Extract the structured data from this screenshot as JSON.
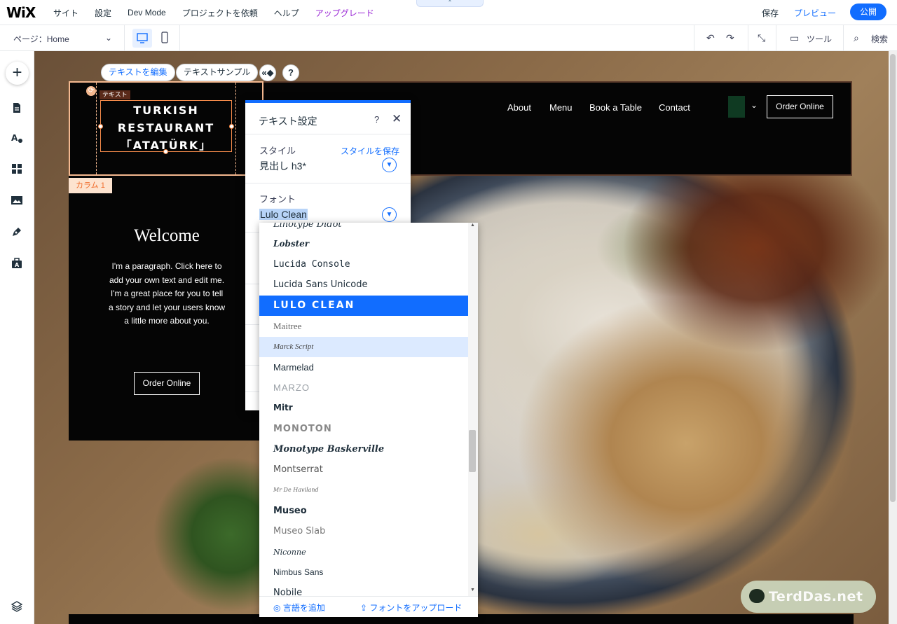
{
  "topbar": {
    "logo": "WiX",
    "menu": [
      "サイト",
      "設定",
      "Dev Mode",
      "プロジェクトを依頼",
      "ヘルプ",
      "アップグレード"
    ],
    "center_tab": "⌃",
    "save": "保存",
    "preview": "プレビュー",
    "publish": "公開"
  },
  "secondbar": {
    "page_select": "ページ：Home",
    "tools": "ツール",
    "search": "検索"
  },
  "leftbar": {
    "icons": [
      "add-icon",
      "pages-icon",
      "design-icon",
      "apps-icon",
      "media-icon",
      "blog-icon",
      "business-icon",
      "layers-icon"
    ]
  },
  "canvas": {
    "float_buttons": [
      "テキストを編集",
      "テキストサンプル"
    ],
    "help_label": "?",
    "text_tag": "テキスト",
    "column_label": "カラム 1",
    "logo_lines": [
      "TURKISH",
      "RESTAURANT",
      "「ATATÜRK」"
    ],
    "nav": [
      "About",
      "Menu",
      "Book a Table",
      "Contact"
    ],
    "header_order": "Order Online",
    "welcome": "Welcome",
    "paragraph": "I'm a paragraph. Click here to add your own text and edit me. I'm a great place for you to tell a story and let your users know a little more about you.",
    "column_order": "Order Online",
    "watermark": "TerdDas.net"
  },
  "text_panel": {
    "title": "テキスト設定",
    "help": "?",
    "close": "✕",
    "style_label": "スタイル",
    "save_style": "スタイルを保存",
    "style_value": "見出し h3*",
    "font_label": "フォント",
    "font_value": "Lulo Clean"
  },
  "font_dropdown": {
    "fonts": [
      "Linotype Didot",
      "Lobster",
      "Lucida Console",
      "Lucida Sans Unicode",
      "LULO CLEAN",
      "Maitree",
      "Marck Script",
      "Marmelad",
      "MARZO",
      "Mitr",
      "MONOTON",
      "Monotype Baskerville",
      "Montserrat",
      "Mr De Haviland",
      "Museo",
      "Museo Slab",
      "Niconne",
      "Nimbus Sans",
      "Nobile"
    ],
    "selected": "LULO CLEAN",
    "hovered": "Marck Script",
    "add_language": "言語を追加",
    "upload_font": "フォントをアップロード"
  },
  "colors": {
    "accent": "#116dff",
    "upgrade": "#9a27d5",
    "selection": "#f48a4a",
    "site_black": "#050505"
  }
}
